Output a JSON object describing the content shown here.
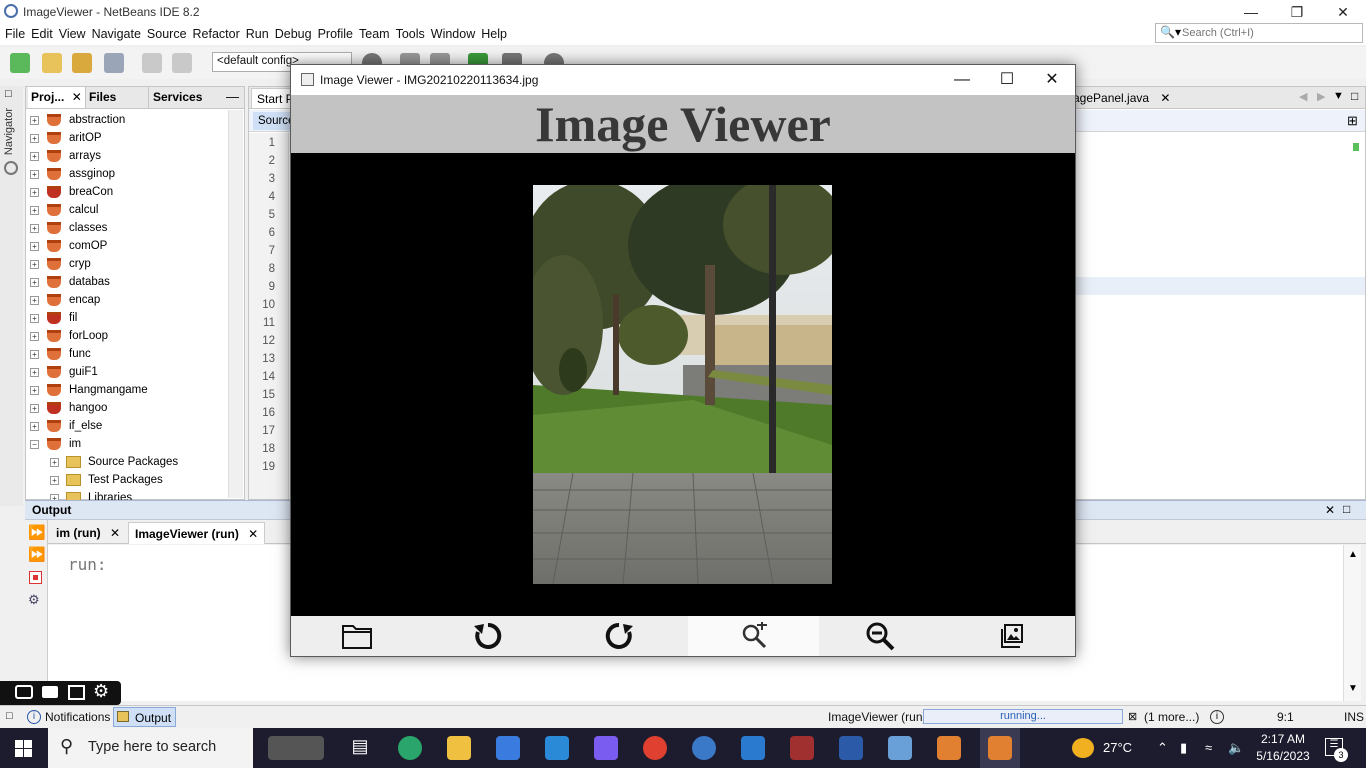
{
  "ide": {
    "window_title": "ImageViewer - NetBeans IDE 8.2",
    "menus": [
      "File",
      "Edit",
      "View",
      "Navigate",
      "Source",
      "Refactor",
      "Run",
      "Debug",
      "Profile",
      "Team",
      "Tools",
      "Window",
      "Help"
    ],
    "search_placeholder": "Search (Ctrl+I)",
    "config_select": "<default config>",
    "navigator_label": "Navigator",
    "project_tabs": [
      "Proj...",
      "Files",
      "Services"
    ],
    "projects": [
      "abstraction",
      "aritOP",
      "arrays",
      "assginop",
      "breaCon",
      "calcul",
      "classes",
      "comOP",
      "cryp",
      "databas",
      "encap",
      "fil",
      "forLoop",
      "func",
      "guiF1",
      "Hangmangame",
      "hangoo",
      "if_else",
      "im"
    ],
    "im_children": [
      "Source Packages",
      "Test Packages",
      "Libraries"
    ],
    "editor_tab_start": "Start P",
    "editor_tab_imagepanel": "agePanel.java",
    "source_button": "Source",
    "line_numbers": [
      "1",
      "2",
      "3",
      "4",
      "5",
      "6",
      "7",
      "8",
      "9",
      "10",
      "11",
      "12",
      "13",
      "14",
      "15",
      "16",
      "17",
      "18",
      "19"
    ],
    "output_title": "Output",
    "output_tabs": [
      "im (run)",
      "ImageViewer (run)"
    ],
    "output_text": "run:",
    "status": {
      "notifications": "Notifications",
      "output": "Output",
      "run_name": "ImageViewer (run)",
      "progress_text": "running...",
      "more": "(1 more...)",
      "position": "9:1",
      "mode": "INS"
    }
  },
  "image_viewer": {
    "window_title": "Image Viewer - IMG20210220113634.jpg",
    "heading": "Image Viewer",
    "toolbar_buttons": [
      "open-folder",
      "rotate-left",
      "rotate-right",
      "zoom-in",
      "zoom-out",
      "gallery"
    ]
  },
  "taskbar": {
    "search_placeholder": "Type here to search",
    "weather": "27°C",
    "time": "2:17 AM",
    "date": "5/16/2023",
    "notification_count": "3"
  },
  "colors": {
    "accent": "#4a6ea9",
    "viewer_header_bg": "#c3c3c3",
    "taskbar_bg": "#1c1c2e"
  }
}
